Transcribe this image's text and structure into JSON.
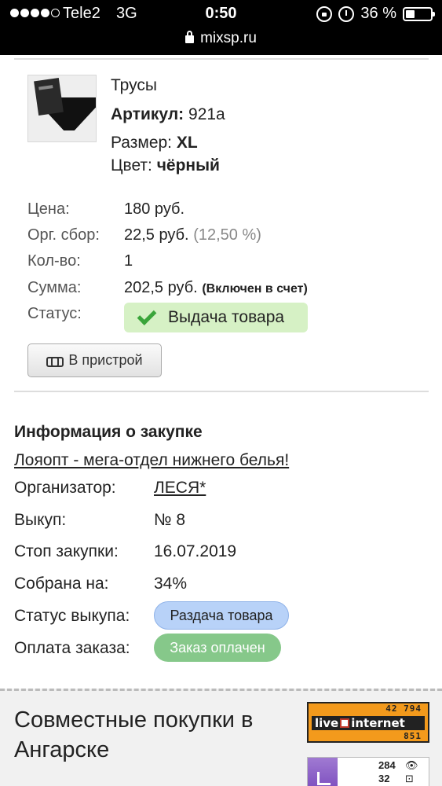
{
  "status_bar": {
    "carrier": "Tele2",
    "network": "3G",
    "time": "0:50",
    "battery": "36 %",
    "battery_level": 0.36,
    "url": "mixsp.ru"
  },
  "product": {
    "name": "Трусы",
    "article_label": "Артикул:",
    "article_value": "921а",
    "size_label": "Размер:",
    "size_value": "XL",
    "color_label": "Цвет:",
    "color_value": "чёрный"
  },
  "order": {
    "price_label": "Цена:",
    "price_value": "180 руб.",
    "fee_label": "Орг. сбор:",
    "fee_value": "22,5 руб.",
    "fee_percent": "(12,50 %)",
    "qty_label": "Кол-во:",
    "qty_value": "1",
    "sum_label": "Сумма:",
    "sum_value": "202,5 руб.",
    "sum_note": "(Включен в счет)",
    "status_label": "Статус:",
    "status_value": "Выдача товара",
    "storage_button": "В пристрой"
  },
  "purchase": {
    "section_title": "Информация о закупке",
    "title_link": "Лояопт - мега-отдел нижнего белья!",
    "organizer_label": "Организатор:",
    "organizer_value": "ЛЕСЯ*",
    "batch_label": "Выкуп:",
    "batch_value": "№ 8",
    "stop_label": "Стоп закупки:",
    "stop_value": "16.07.2019",
    "collected_label": "Собрана на:",
    "collected_value": "34%",
    "batch_status_label": "Статус выкупа:",
    "batch_status_value": "Раздача товара",
    "payment_label": "Оплата заказа:",
    "payment_value": "Заказ оплачен"
  },
  "footer": {
    "site_title": "Совместные покупки в Ангарске",
    "li_top": "42 794",
    "li_brand_left": "live",
    "li_brand_right": "internet",
    "li_bottom": "851",
    "stat_views": "284",
    "stat_views_icon": "👁",
    "stat_visits": "32",
    "stat_visits_icon": "⊡"
  },
  "colors": {
    "status_green_bg": "#d6f1c5",
    "batch_status_blue": "#b8d2f8",
    "payment_green": "#86c88a",
    "liveinternet_orange": "#f39a1c"
  }
}
